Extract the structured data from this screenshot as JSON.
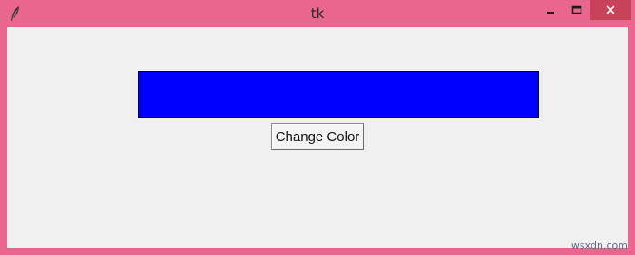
{
  "window": {
    "title": "tk",
    "icon": "feather-icon",
    "controls": [
      "minimize-icon",
      "maximize-icon",
      "close-icon"
    ],
    "frame_color": "#e9678f",
    "close_button_color": "#c8435a"
  },
  "canvas": {
    "fill_color": "#0000ff"
  },
  "button": {
    "label": "Change Color"
  },
  "watermark": "wsxdn.com"
}
